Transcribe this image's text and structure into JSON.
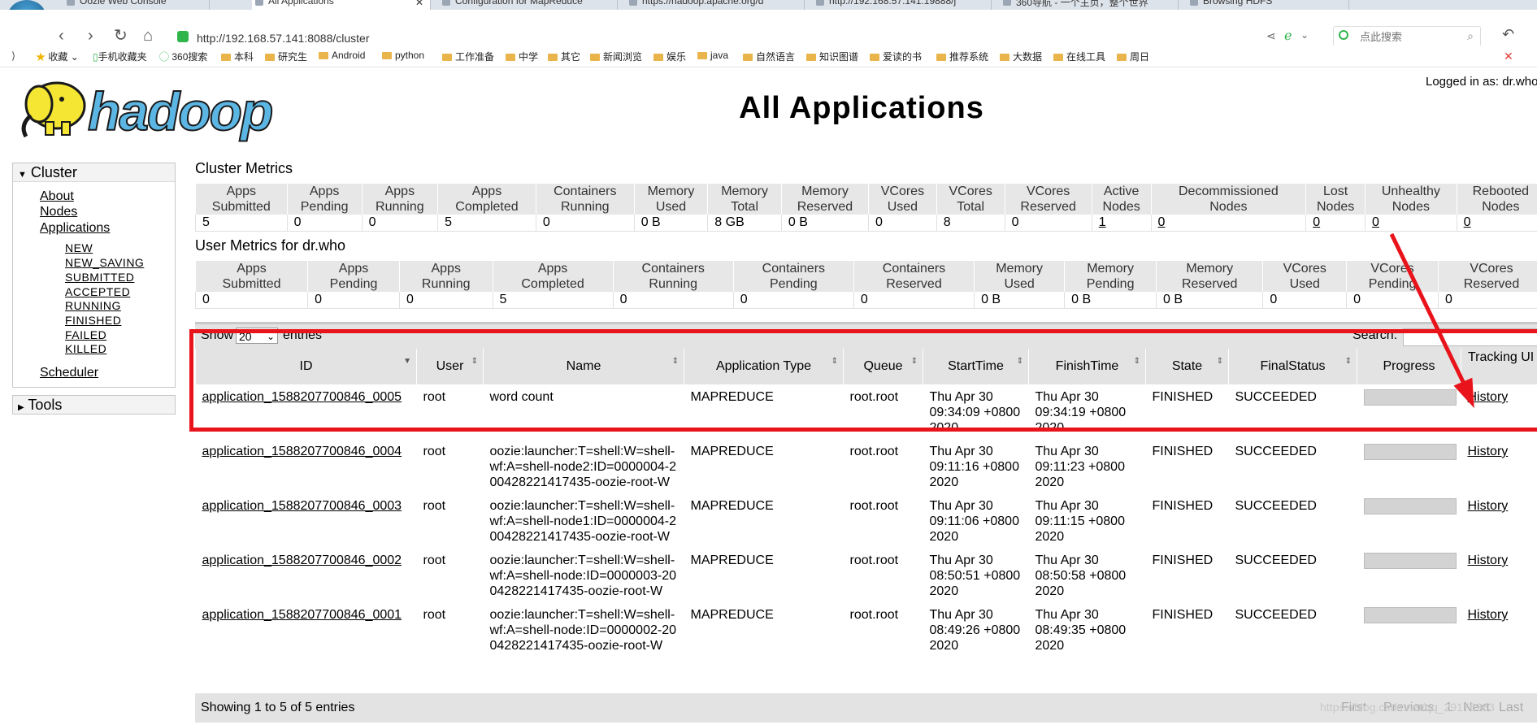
{
  "browser": {
    "tabs": [
      "Oozie Web Console",
      "All Applications",
      "Configuration for MapReduce",
      "https://hadoop.apache.org/d",
      "http://192.168.57.141:19888/j",
      "360导航 - 一个主页，整个世界",
      "Browsing HDFS"
    ],
    "url": "http://192.168.57.141:8088/cluster",
    "search_placeholder": "点此搜索",
    "bookmarks": [
      "收藏",
      "手机收藏夹",
      "360搜索",
      "本科",
      "研究生",
      "Android",
      "python",
      "工作准备",
      "中学",
      "其它",
      "新闻浏览",
      "娱乐",
      "java",
      "自然语言",
      "知识图谱",
      "爱读的书",
      "推荐系统",
      "大数据",
      "在线工具",
      "周日"
    ]
  },
  "header": {
    "logo_text": "hadoop",
    "title": "All Applications",
    "logged_in": "Logged in as: dr.who"
  },
  "sidebar": {
    "cluster_label": "Cluster",
    "links": [
      "About",
      "Nodes",
      "Applications"
    ],
    "app_states": [
      "NEW",
      "NEW_SAVING",
      "SUBMITTED",
      "ACCEPTED",
      "RUNNING",
      "FINISHED",
      "FAILED",
      "KILLED"
    ],
    "scheduler": "Scheduler",
    "tools_label": "Tools"
  },
  "cluster_metrics": {
    "title": "Cluster Metrics",
    "headers": [
      [
        "Apps",
        "Submitted"
      ],
      [
        "Apps",
        "Pending"
      ],
      [
        "Apps",
        "Running"
      ],
      [
        "Apps",
        "Completed"
      ],
      [
        "Containers",
        "Running"
      ],
      [
        "Memory",
        "Used"
      ],
      [
        "Memory",
        "Total"
      ],
      [
        "Memory",
        "Reserved"
      ],
      [
        "VCores",
        "Used"
      ],
      [
        "VCores",
        "Total"
      ],
      [
        "VCores",
        "Reserved"
      ],
      [
        "Active",
        "Nodes"
      ],
      [
        "Decommissioned",
        "Nodes"
      ],
      [
        "Lost",
        "Nodes"
      ],
      [
        "Unhealthy",
        "Nodes"
      ],
      [
        "Rebooted",
        "Nodes"
      ]
    ],
    "values": [
      "5",
      "0",
      "0",
      "5",
      "0",
      "0 B",
      "8 GB",
      "0 B",
      "0",
      "8",
      "0",
      "1",
      "0",
      "0",
      "0",
      "0"
    ]
  },
  "user_metrics": {
    "title": "User Metrics for dr.who",
    "headers": [
      [
        "Apps",
        "Submitted"
      ],
      [
        "Apps",
        "Pending"
      ],
      [
        "Apps",
        "Running"
      ],
      [
        "Apps",
        "Completed"
      ],
      [
        "Containers",
        "Running"
      ],
      [
        "Containers",
        "Pending"
      ],
      [
        "Containers",
        "Reserved"
      ],
      [
        "Memory",
        "Used"
      ],
      [
        "Memory",
        "Pending"
      ],
      [
        "Memory",
        "Reserved"
      ],
      [
        "VCores",
        "Used"
      ],
      [
        "VCores",
        "Pending"
      ],
      [
        "VCores",
        "Reserved"
      ]
    ],
    "values": [
      "0",
      "0",
      "0",
      "5",
      "0",
      "0",
      "0",
      "0 B",
      "0 B",
      "0 B",
      "0",
      "0",
      "0"
    ]
  },
  "apps_table": {
    "show_label": "Show",
    "entries_value": "20",
    "entries_label": "entries",
    "search_label": "Search:",
    "columns": [
      "ID",
      "User",
      "Name",
      "Application Type",
      "Queue",
      "StartTime",
      "FinishTime",
      "State",
      "FinalStatus",
      "Progress",
      "Tracking UI"
    ],
    "rows": [
      {
        "id": "application_1588207700846_0005",
        "user": "root",
        "name": "word count",
        "type": "MAPREDUCE",
        "queue": "root.root",
        "start": "Thu Apr 30 09:34:09 +0800 2020",
        "finish": "Thu Apr 30 09:34:19 +0800 2020",
        "state": "FINISHED",
        "final": "SUCCEEDED",
        "tracking": "History"
      },
      {
        "id": "application_1588207700846_0004",
        "user": "root",
        "name": "oozie:launcher:T=shell:W=shell-wf:A=shell-node2:ID=0000004-200428221417435-oozie-root-W",
        "type": "MAPREDUCE",
        "queue": "root.root",
        "start": "Thu Apr 30 09:11:16 +0800 2020",
        "finish": "Thu Apr 30 09:11:23 +0800 2020",
        "state": "FINISHED",
        "final": "SUCCEEDED",
        "tracking": "History"
      },
      {
        "id": "application_1588207700846_0003",
        "user": "root",
        "name": "oozie:launcher:T=shell:W=shell-wf:A=shell-node1:ID=0000004-200428221417435-oozie-root-W",
        "type": "MAPREDUCE",
        "queue": "root.root",
        "start": "Thu Apr 30 09:11:06 +0800 2020",
        "finish": "Thu Apr 30 09:11:15 +0800 2020",
        "state": "FINISHED",
        "final": "SUCCEEDED",
        "tracking": "History"
      },
      {
        "id": "application_1588207700846_0002",
        "user": "root",
        "name": "oozie:launcher:T=shell:W=shell-wf:A=shell-node:ID=0000003-200428221417435-oozie-root-W",
        "type": "MAPREDUCE",
        "queue": "root.root",
        "start": "Thu Apr 30 08:50:51 +0800 2020",
        "finish": "Thu Apr 30 08:50:58 +0800 2020",
        "state": "FINISHED",
        "final": "SUCCEEDED",
        "tracking": "History"
      },
      {
        "id": "application_1588207700846_0001",
        "user": "root",
        "name": "oozie:launcher:T=shell:W=shell-wf:A=shell-node:ID=0000002-200428221417435-oozie-root-W",
        "type": "MAPREDUCE",
        "queue": "root.root",
        "start": "Thu Apr 30 08:49:26 +0800 2020",
        "finish": "Thu Apr 30 08:49:35 +0800 2020",
        "state": "FINISHED",
        "final": "SUCCEEDED",
        "tracking": "History"
      }
    ],
    "footer": "Showing 1 to 5 of 5 entries",
    "pager": [
      "First",
      "Previous",
      "1",
      "Next",
      "Last"
    ]
  },
  "watermark": "https://blog.csdn.net/qq_29176963",
  "colors": {
    "highlight": "#e8131b",
    "header_bg": "#e3e3e3",
    "logo_yellow": "#f5e633",
    "logo_blue": "#5cb6e4"
  }
}
